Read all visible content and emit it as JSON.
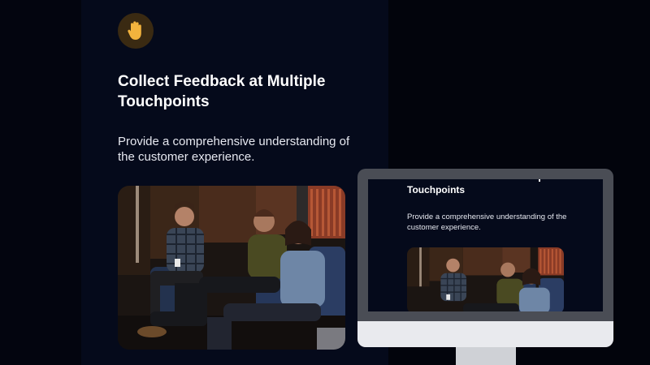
{
  "feature": {
    "icon": "raised-hand-icon",
    "title": "Collect Feedback at Multiple Touchpoints",
    "description": "Provide a comprehensive understanding of the customer experience.",
    "image": "Audience members seated in a dimly lit auditorium listening to a speaker holding a microphone"
  },
  "monitor_preview": {
    "title": "Touchpoints",
    "description": "Provide a comprehensive understanding of the customer experience."
  },
  "colors": {
    "background": "#03050f",
    "panel": "#050a1b",
    "icon_badge": "#3a2a12",
    "hand": "#f2b33d",
    "monitor_frame": "#4a4d55",
    "monitor_chin": "#e9eaee"
  }
}
